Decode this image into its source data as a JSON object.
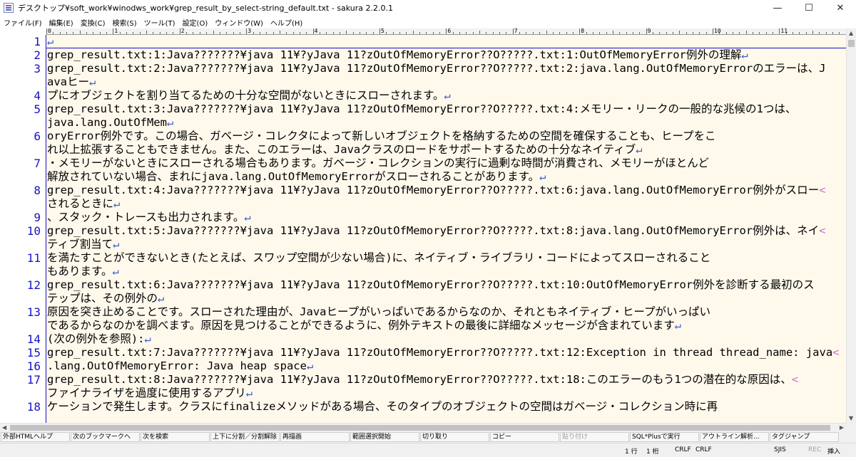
{
  "window": {
    "title": "デスクトップ¥soft_work¥winodws_work¥grep_result_by_select-string_default.txt - sakura 2.2.0.1",
    "minimize_glyph": "—",
    "maximize_glyph": "☐",
    "close_glyph": "✕"
  },
  "menu": [
    "ファイル(F)",
    "編集(E)",
    "変換(C)",
    "検索(S)",
    "ツール(T)",
    "設定(O)",
    "ウィンドウ(W)",
    "ヘルプ(H)"
  ],
  "ruler": {
    "labels": [
      "0",
      "1",
      "2",
      "3",
      "4",
      "5",
      "6",
      "7",
      "8",
      "9",
      "10",
      "11"
    ]
  },
  "editor": {
    "eol_mark": "↵",
    "wrap_mark": "<",
    "rows": [
      {
        "num": "1",
        "text": "",
        "eol": true
      },
      {
        "num": "2",
        "text": "grep_result.txt:1:Java???????¥java 11¥?yJava 11?zOutOfMemoryError??O?????.txt:1:OutOfMemoryError例外の理解",
        "eol": true
      },
      {
        "num": "3",
        "text": "grep_result.txt:2:Java???????¥java 11¥?yJava 11?zOutOfMemoryError??O?????.txt:2:java.lang.OutOfMemoryErrorのエラーは、J"
      },
      {
        "num": "",
        "text": "avaヒー",
        "eol": true
      },
      {
        "num": "4",
        "text": "プにオブジェクトを割り当てるための十分な空間がないときにスローされます。",
        "eol": true
      },
      {
        "num": "5",
        "text": "grep_result.txt:3:Java???????¥java 11¥?yJava 11?zOutOfMemoryError??O?????.txt:4:メモリー・リークの一般的な兆候の1つは、"
      },
      {
        "num": "",
        "text": "java.lang.OutOfMem",
        "eol": true
      },
      {
        "num": "6",
        "text": "oryError例外です。この場合、ガベージ・コレクタによって新しいオブジェクトを格納するための空間を確保することも、ヒープをこ"
      },
      {
        "num": "",
        "text": "れ以上拡張することもできません。また、このエラーは、Javaクラスのロードをサポートするための十分なネイティブ",
        "eol": true
      },
      {
        "num": "7",
        "text": "・メモリーがないときにスローされる場合もあります。ガベージ・コレクションの実行に過剰な時間が消費され、メモリーがほとんど"
      },
      {
        "num": "",
        "text": "解放されていない場合、まれにjava.lang.OutOfMemoryErrorがスローされることがあります。",
        "eol": true
      },
      {
        "num": "8",
        "text": "grep_result.txt:4:Java???????¥java 11¥?yJava 11?zOutOfMemoryError??O?????.txt:6:java.lang.OutOfMemoryError例外がスロー",
        "wrap": true
      },
      {
        "num": "",
        "text": "されるときに",
        "eol": true
      },
      {
        "num": "9",
        "text": "、スタック・トレースも出力されます。",
        "eol": true
      },
      {
        "num": "10",
        "text": "grep_result.txt:5:Java???????¥java 11¥?yJava 11?zOutOfMemoryError??O?????.txt:8:java.lang.OutOfMemoryError例外は、ネイ",
        "wrap": true
      },
      {
        "num": "",
        "text": "ティブ割当て",
        "eol": true
      },
      {
        "num": "11",
        "text": "を満たすことができないとき(たとえば、スワップ空間が少ない場合)に、ネイティブ・ライブラリ・コードによってスローされること"
      },
      {
        "num": "",
        "text": "もあります。",
        "eol": true
      },
      {
        "num": "12",
        "text": "grep_result.txt:6:Java???????¥java 11¥?yJava 11?zOutOfMemoryError??O?????.txt:10:OutOfMemoryError例外を診断する最初のス"
      },
      {
        "num": "",
        "text": "テップは、その例外の",
        "eol": true
      },
      {
        "num": "13",
        "text": "原因を突き止めることです。スローされた理由が、Javaヒープがいっぱいであるからなのか、それともネイティブ・ヒープがいっぱい"
      },
      {
        "num": "",
        "text": "であるからなのかを調べます。原因を見つけることができるように、例外テキストの最後に詳細なメッセージが含まれています",
        "eol": true
      },
      {
        "num": "14",
        "text": "(次の例外を参照):",
        "eol": true
      },
      {
        "num": "15",
        "text": "grep_result.txt:7:Java???????¥java 11¥?yJava 11?zOutOfMemoryError??O?????.txt:12:Exception in thread thread_name: java",
        "wrap": true
      },
      {
        "num": "16",
        "text": ".lang.OutOfMemoryError: Java heap space",
        "eol": true
      },
      {
        "num": "17",
        "text": "grep_result.txt:8:Java???????¥java 11¥?yJava 11?zOutOfMemoryError??O?????.txt:18:このエラーのもう1つの潜在的な原因は、",
        "wrap": true
      },
      {
        "num": "",
        "text": "ファイナライザを過度に使用するアプリ",
        "eol": true
      },
      {
        "num": "18",
        "text": "ケーションで発生します。クラスにfinalizeメソッドがある場合、そのタイプのオブジェクトの空間はガベージ・コレクション時に再"
      }
    ]
  },
  "function_keys": [
    {
      "label": "外部HTMLヘルプ",
      "enabled": true
    },
    {
      "label": "次のブックマークへ",
      "enabled": true
    },
    {
      "label": "次を検索",
      "enabled": true
    },
    {
      "label": "上下に分割／分割解除",
      "enabled": true
    },
    {
      "label": "再描画",
      "enabled": true
    },
    {
      "label": "範囲選択開始",
      "enabled": true
    },
    {
      "label": "切り取り",
      "enabled": true
    },
    {
      "label": "コピー",
      "enabled": true
    },
    {
      "label": "貼り付け",
      "enabled": false
    },
    {
      "label": "SQL*Plusで実行",
      "enabled": true
    },
    {
      "label": "アウトライン解析...",
      "enabled": true
    },
    {
      "label": "タグジャンプ",
      "enabled": true
    }
  ],
  "status": {
    "line": "1 行",
    "column": "1 桁",
    "eol_code": "CRLF",
    "eol_input": "CRLF",
    "encoding": "SJIS",
    "rec": "REC",
    "mode": "挿入"
  }
}
